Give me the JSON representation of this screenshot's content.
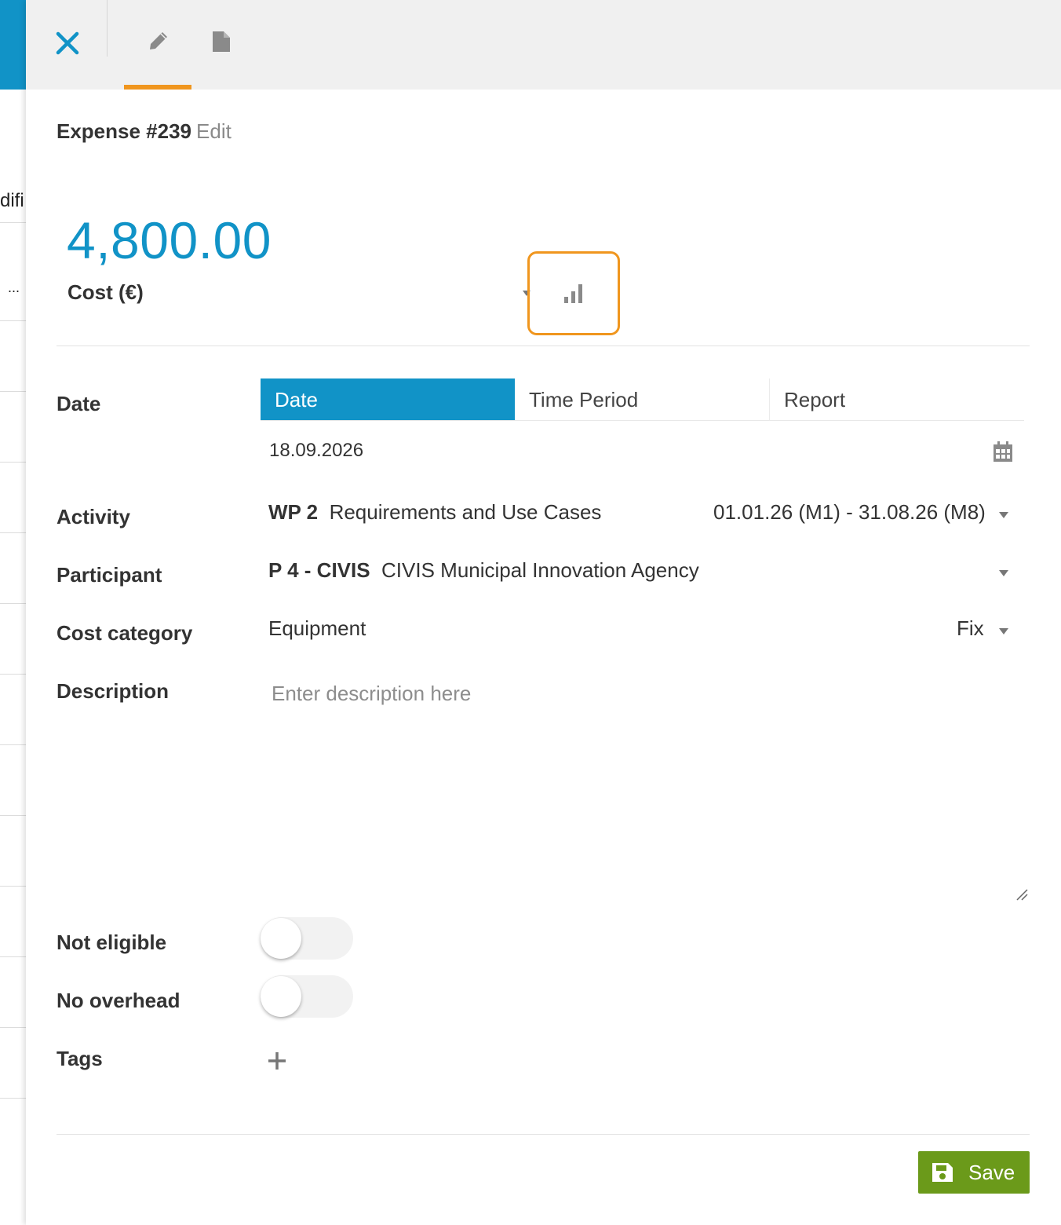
{
  "background": {
    "fragment_1": "difi",
    "fragment_2": "..."
  },
  "header": {
    "close_icon": "close-icon",
    "edit_tab_icon": "pencil-icon",
    "document_tab_icon": "document-icon"
  },
  "title": {
    "main": "Expense #239",
    "mode": "Edit"
  },
  "cost": {
    "amount": "4,800.00",
    "label": "Cost (€)",
    "chart_icon": "bar-chart-icon"
  },
  "date": {
    "label": "Date",
    "options": [
      "Date",
      "Time Period",
      "Report"
    ],
    "selected": "Date",
    "value": "18.09.2026"
  },
  "activity": {
    "label": "Activity",
    "code": "WP 2",
    "name": "Requirements and Use Cases",
    "range": "01.01.26 (M1)  -  31.08.26 (M8)"
  },
  "participant": {
    "label": "Participant",
    "code": "P 4 - CIVIS",
    "name": "CIVIS Municipal Innovation Agency"
  },
  "cost_category": {
    "label": "Cost category",
    "value": "Equipment",
    "type": "Fix"
  },
  "description": {
    "label": "Description",
    "placeholder": "Enter description here"
  },
  "not_eligible": {
    "label": "Not eligible",
    "on": false
  },
  "no_overhead": {
    "label": "No overhead",
    "on": false
  },
  "tags": {
    "label": "Tags"
  },
  "footer": {
    "save_label": "Save"
  },
  "colors": {
    "accent_blue": "#1193c7",
    "accent_orange": "#f0961e",
    "save_green": "#6b9a1a"
  }
}
